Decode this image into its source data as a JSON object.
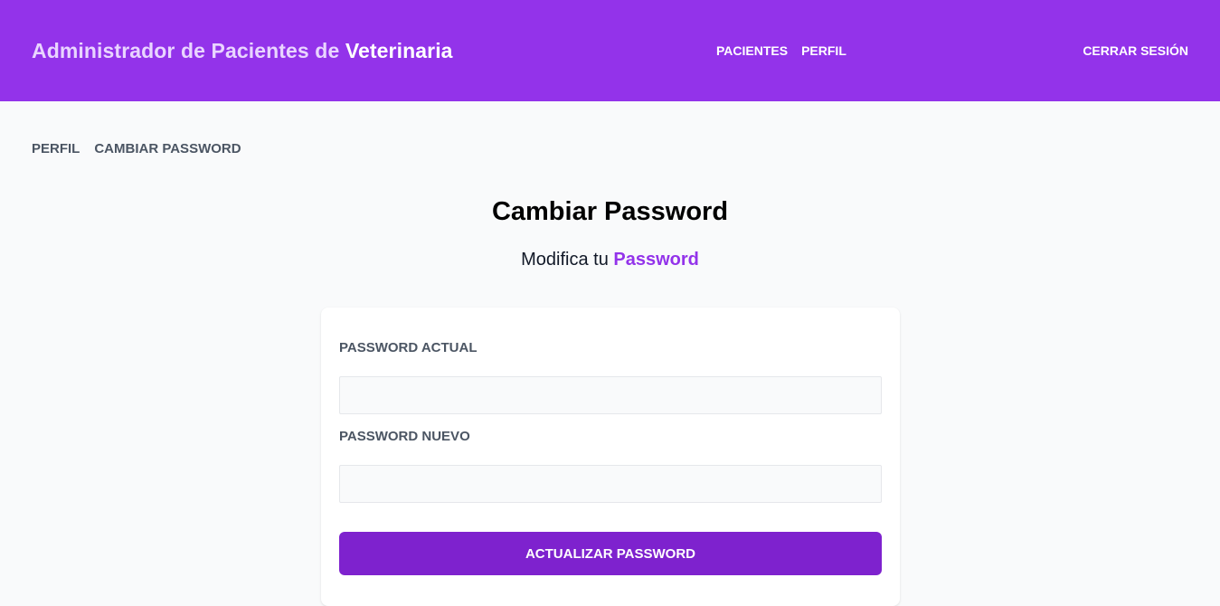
{
  "header": {
    "brand_prefix": "Administrador de Pacientes de",
    "brand_highlight": "Veterinaria",
    "nav": [
      {
        "label": "PACIENTES"
      },
      {
        "label": "PERFIL"
      }
    ],
    "logout_label": "CERRAR SESIÓN"
  },
  "subnav": [
    {
      "label": "PERFIL"
    },
    {
      "label": "CAMBIAR PASSWORD"
    }
  ],
  "page": {
    "title": "Cambiar Password",
    "subtitle_prefix": "Modifica tu",
    "subtitle_highlight": "Password"
  },
  "form": {
    "current_password": {
      "label": "PASSWORD ACTUAL",
      "value": "",
      "placeholder": ""
    },
    "new_password": {
      "label": "PASSWORD NUEVO",
      "value": "",
      "placeholder": ""
    },
    "submit_label": "ACTUALIZAR PASSWORD"
  },
  "colors": {
    "header_bg": "#9333ea",
    "brand_light": "#e9d5ff",
    "button_bg": "#7e22ce",
    "accent": "#9333ea",
    "page_bg": "#f9fafb"
  }
}
